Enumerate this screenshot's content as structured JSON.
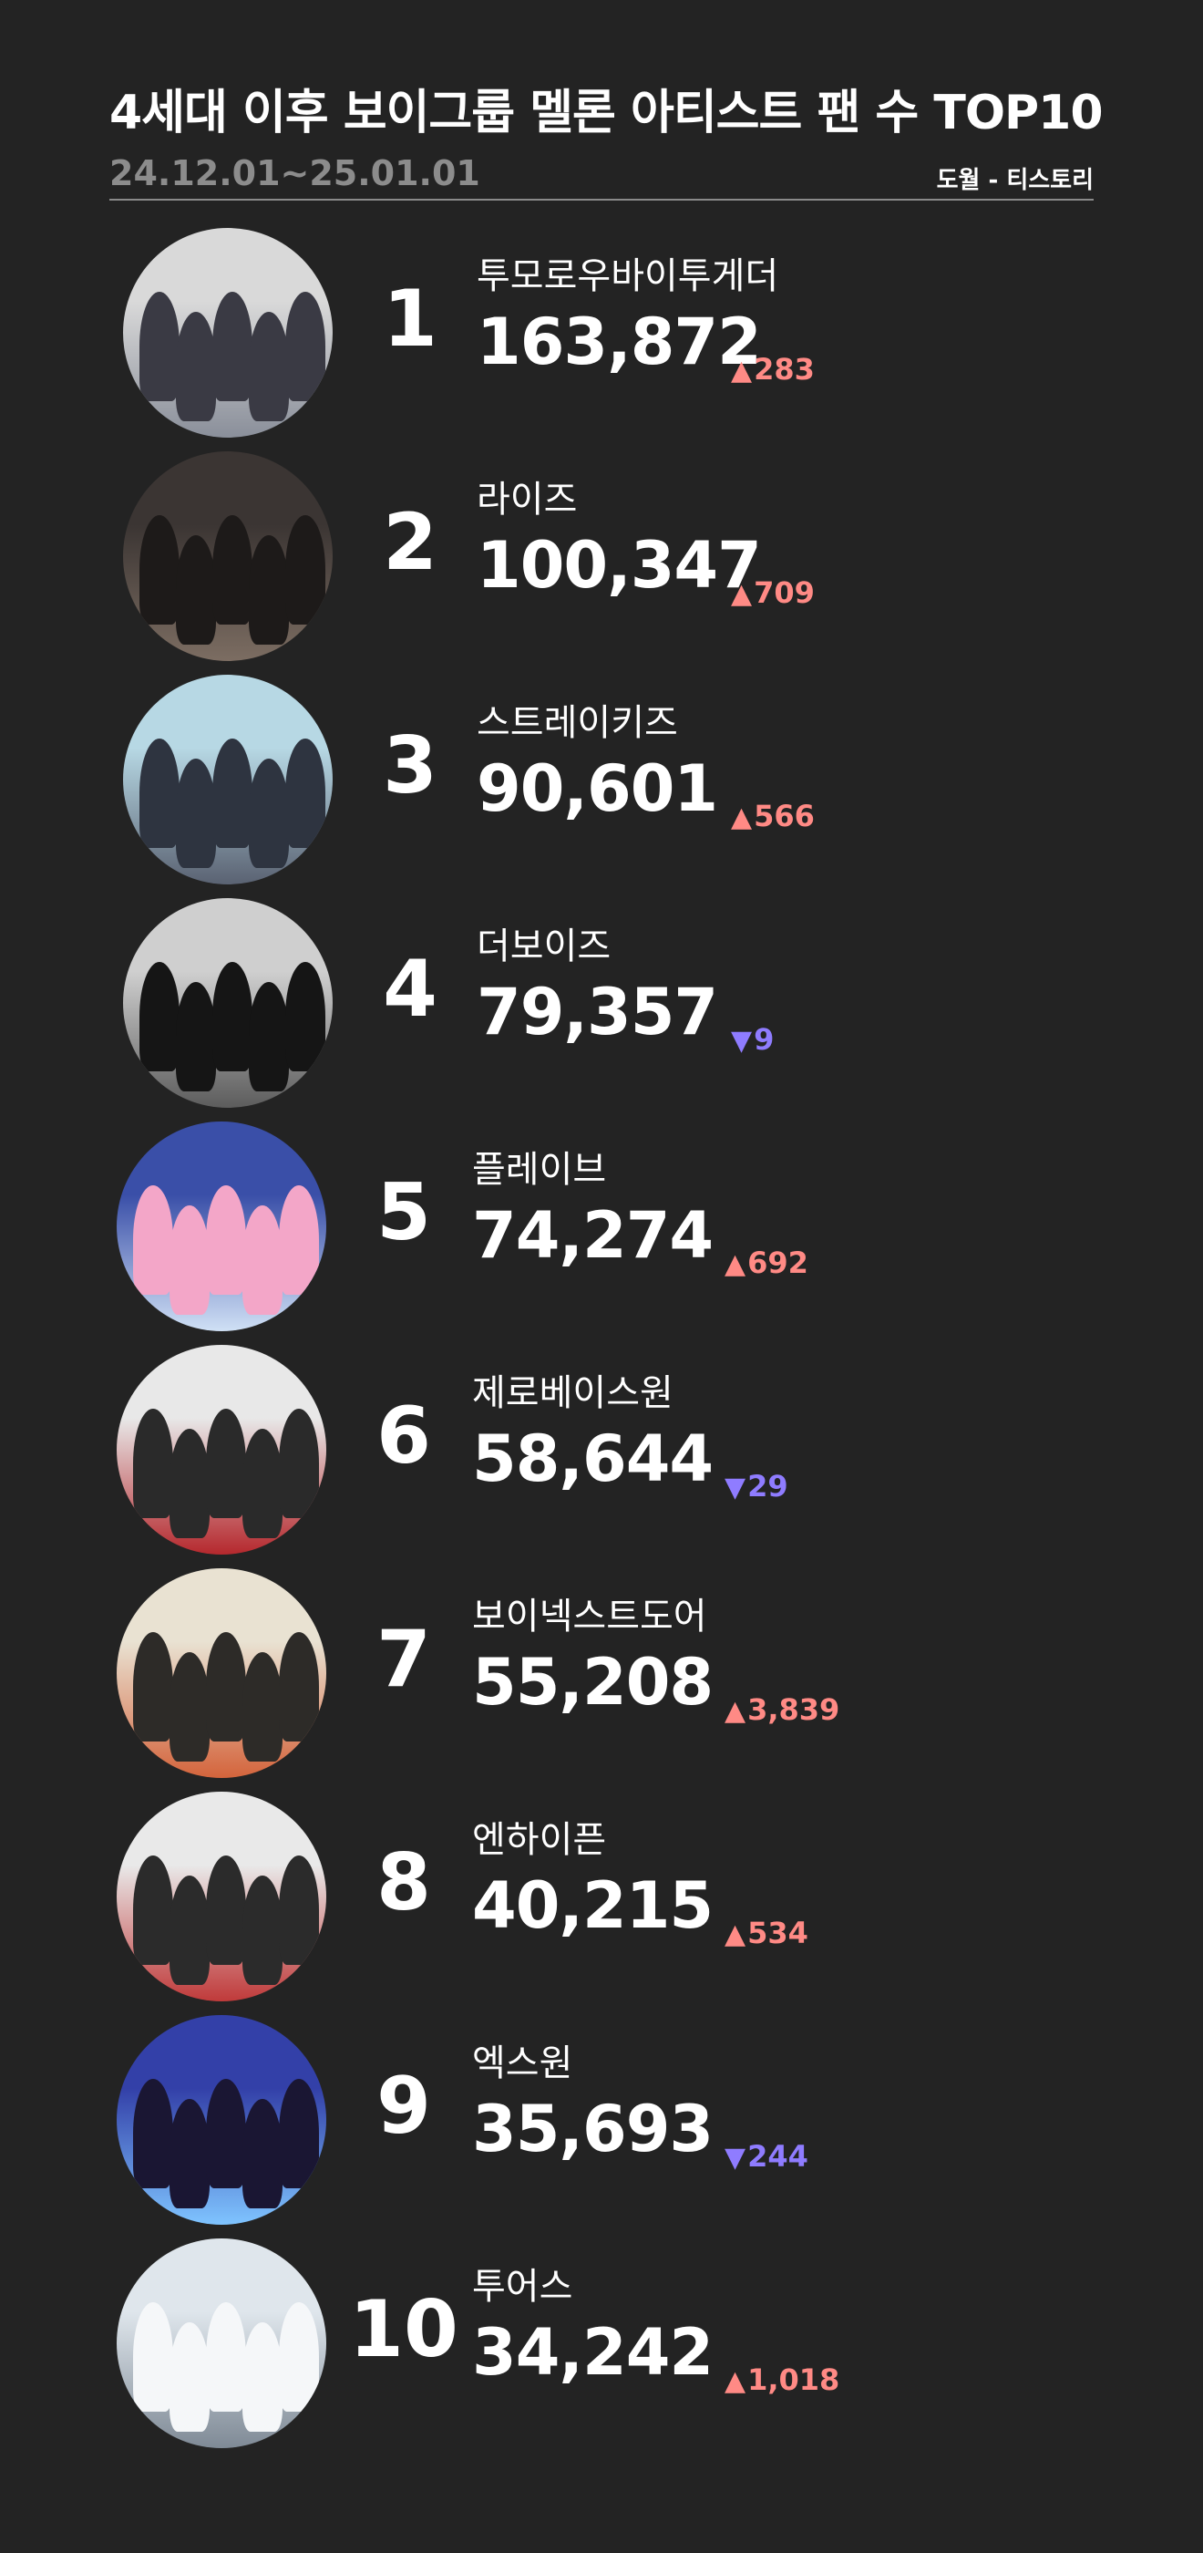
{
  "header": {
    "title": "4세대 이후 보이그룹 멜론 아티스트 팬 수 TOP10",
    "period": "24.12.01~25.01.01",
    "source": "도월 - 티스토리"
  },
  "colors": {
    "background": "#232323",
    "up": "#ff8a85",
    "down": "#8f7cff"
  },
  "rows": [
    {
      "rank": "1",
      "name": "투모로우바이투게더",
      "count": "163,872",
      "arrow": "▲",
      "delta": "283",
      "dir": "up",
      "photo": "group-photo"
    },
    {
      "rank": "2",
      "name": "라이즈",
      "count": "100,347",
      "arrow": "▲",
      "delta": "709",
      "dir": "up",
      "photo": "group-photo"
    },
    {
      "rank": "3",
      "name": "스트레이키즈",
      "count": "90,601",
      "arrow": "▲",
      "delta": "566",
      "dir": "up",
      "photo": "group-photo"
    },
    {
      "rank": "4",
      "name": "더보이즈",
      "count": "79,357",
      "arrow": "▼",
      "delta": "9",
      "dir": "down",
      "photo": "group-photo"
    },
    {
      "rank": "5",
      "name": "플레이브",
      "count": "74,274",
      "arrow": "▲",
      "delta": "692",
      "dir": "up",
      "photo": "group-photo"
    },
    {
      "rank": "6",
      "name": "제로베이스원",
      "count": "58,644",
      "arrow": "▼",
      "delta": "29",
      "dir": "down",
      "photo": "group-photo"
    },
    {
      "rank": "7",
      "name": "보이넥스트도어",
      "count": "55,208",
      "arrow": "▲",
      "delta": "3,839",
      "dir": "up",
      "photo": "group-photo"
    },
    {
      "rank": "8",
      "name": "엔하이픈",
      "count": "40,215",
      "arrow": "▲",
      "delta": "534",
      "dir": "up",
      "photo": "group-photo"
    },
    {
      "rank": "9",
      "name": "엑스원",
      "count": "35,693",
      "arrow": "▼",
      "delta": "244",
      "dir": "down",
      "photo": "group-photo"
    },
    {
      "rank": "10",
      "name": "투어스",
      "count": "34,242",
      "arrow": "▲",
      "delta": "1,018",
      "dir": "up",
      "photo": "group-photo"
    }
  ]
}
